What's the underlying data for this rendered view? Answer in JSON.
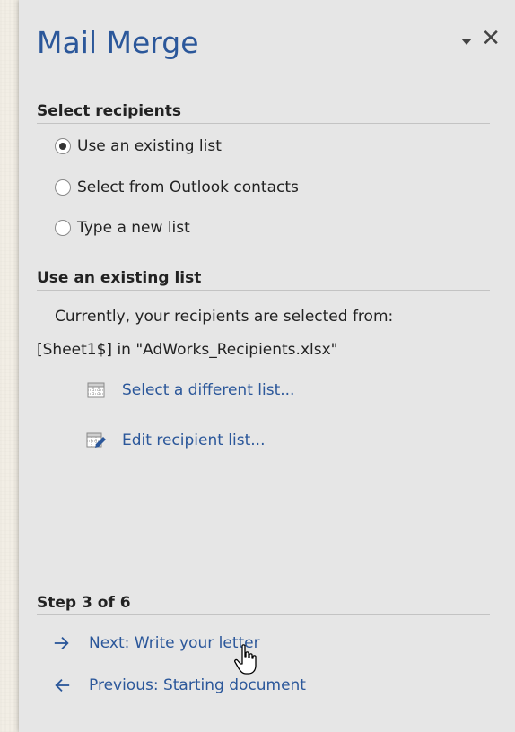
{
  "pane": {
    "title": "Mail Merge",
    "options_icon": "dropdown-triangle-icon",
    "close_glyph": "✕"
  },
  "select_recipients": {
    "heading": "Select recipients",
    "options": [
      {
        "label": "Use an existing list",
        "checked": true
      },
      {
        "label": "Select from Outlook contacts",
        "checked": false
      },
      {
        "label": "Type a new list",
        "checked": false
      }
    ]
  },
  "existing_list": {
    "heading": "Use an existing list",
    "description": "Currently, your recipients are selected from:",
    "source": "[Sheet1$] in \"AdWorks_Recipients.xlsx\"",
    "links": [
      {
        "label": "Select a different list...",
        "icon": "table-icon"
      },
      {
        "label": "Edit recipient list...",
        "icon": "edit-table-icon"
      }
    ]
  },
  "step": {
    "heading": "Step 3 of 6",
    "next": {
      "label": "Next: Write your letter",
      "icon": "arrow-right-icon"
    },
    "previous": {
      "label": "Previous: Starting document",
      "icon": "arrow-left-icon"
    }
  },
  "colors": {
    "accent": "#2b579a",
    "pane_background": "#e6e6e6",
    "text": "#222222"
  }
}
